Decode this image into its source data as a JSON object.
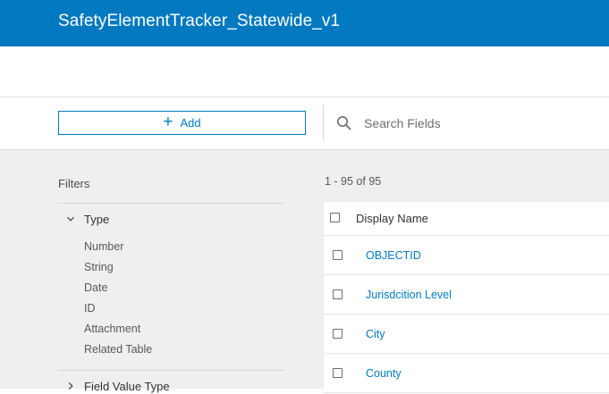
{
  "app": {
    "title": "SafetyElementTracker_Statewide_v1"
  },
  "toolbar": {
    "add_label": "Add",
    "search_placeholder": "Search Fields"
  },
  "filters": {
    "title": "Filters",
    "type_group": {
      "label": "Type",
      "expanded": true,
      "options": [
        "Number",
        "String",
        "Date",
        "ID",
        "Attachment",
        "Related Table"
      ]
    },
    "value_type_group": {
      "label": "Field Value Type",
      "expanded": false
    }
  },
  "results": {
    "count_text": "1 - 95 of 95",
    "column_header": "Display Name",
    "rows": [
      "OBJECTID",
      "Jurisdcition Level",
      "City",
      "County"
    ]
  },
  "colors": {
    "brand": "#0079c1",
    "panel_bg": "#efefef",
    "link": "#0079c1"
  },
  "icons": [
    "plus-icon",
    "search-icon",
    "chevron-down-icon",
    "chevron-right-icon"
  ]
}
